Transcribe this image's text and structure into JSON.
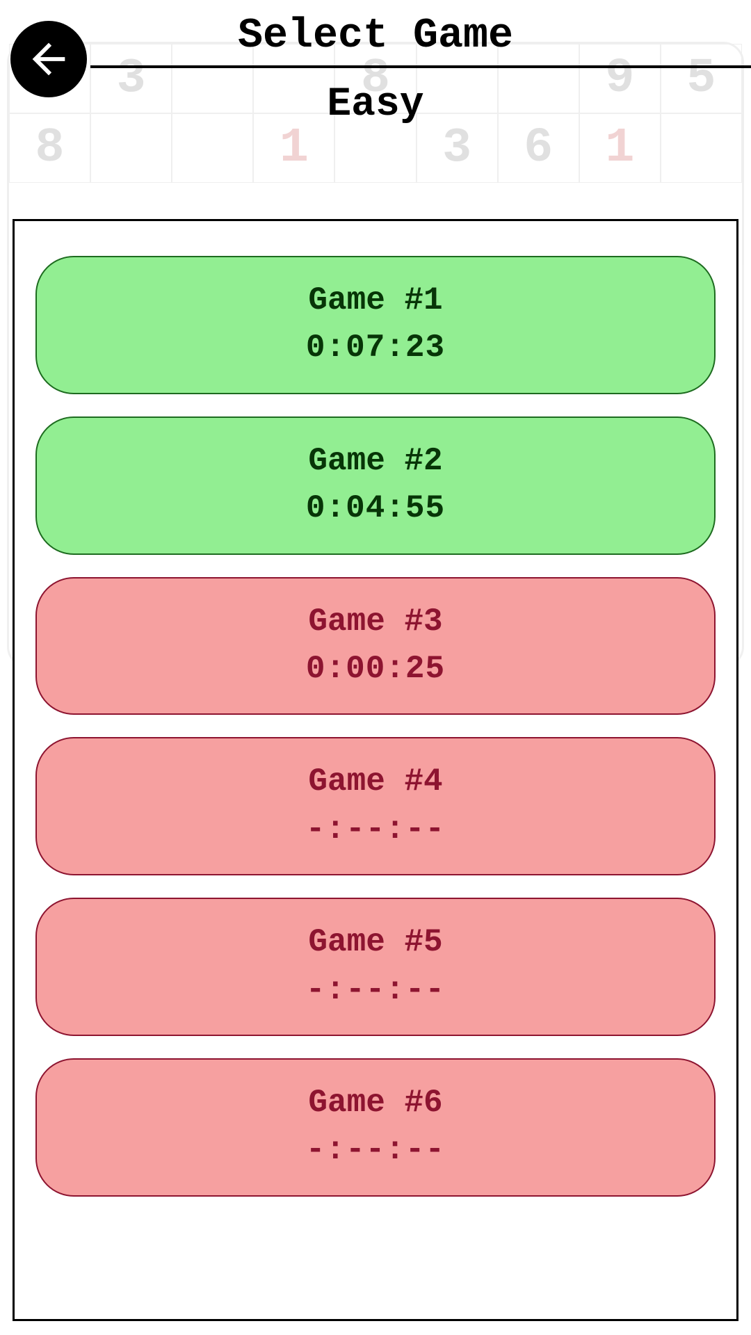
{
  "header": {
    "title": "Select Game",
    "difficulty": "Easy"
  },
  "background_board": [
    [
      "",
      "3",
      "",
      "",
      "8",
      "",
      "",
      "9",
      "5"
    ],
    [
      "8",
      "",
      "",
      "1",
      "",
      "3",
      "6",
      "1",
      ""
    ]
  ],
  "games": [
    {
      "label": "Game #1",
      "time": "0:07:23",
      "status": "completed"
    },
    {
      "label": "Game #2",
      "time": "0:04:55",
      "status": "completed"
    },
    {
      "label": "Game #3",
      "time": "0:00:25",
      "status": "incomplete"
    },
    {
      "label": "Game #4",
      "time": "-:--:--",
      "status": "incomplete"
    },
    {
      "label": "Game #5",
      "time": "-:--:--",
      "status": "incomplete"
    },
    {
      "label": "Game #6",
      "time": "-:--:--",
      "status": "incomplete"
    }
  ],
  "colors": {
    "completed_bg": "#92ee92",
    "incomplete_bg": "#f6a0a0"
  }
}
